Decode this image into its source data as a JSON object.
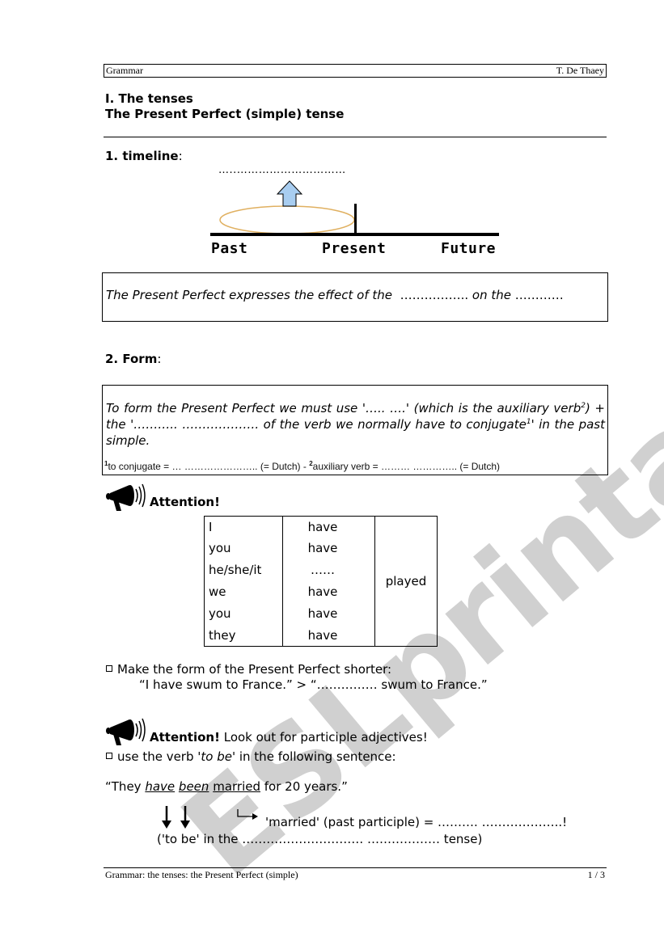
{
  "header": {
    "left": "Grammar",
    "right": "T. De Thaey"
  },
  "titles": {
    "main": "I. The tenses",
    "sub": "The Present Perfect (simple) tense"
  },
  "section1": {
    "heading_num": "1. timeline",
    "heading_colon": ":",
    "timeline": {
      "blank": "…..…………………………",
      "labels": [
        "Past",
        "Present",
        "Future"
      ],
      "colors": {
        "arrow_fill": "#a8cdf0",
        "ellipse_stroke": "#e0b060"
      }
    },
    "box_text": "The Present Perfect expresses the effect of the  …………….. on the ………..",
    "box_parts": {
      "prefix": "The Present Perfect expresses the effect of the",
      "blank1": "……………..",
      "mid": "on the",
      "blank2": "…………"
    }
  },
  "section2": {
    "heading_num": "2. Form",
    "heading_colon": ":",
    "rule": {
      "line1_a": "To form the Present Perfect we must use '….. ….' (which is the auxiliary verb",
      "line1_sup": "2",
      "line1_b": ")",
      "line2_a": "+ the '……….. ………………. of the verb we normally have to conjugate",
      "line2_sup": "1",
      "line2_b": "' in the past simple."
    },
    "footnote": {
      "sup1": "1",
      "part1": "to conjugate = … ………………….. (= Dutch) - ",
      "sup2": "2",
      "part2": "auxiliary verb =  ……… …………..  (= Dutch)"
    }
  },
  "attention1": {
    "label": "Attention!",
    "table": {
      "subjects": [
        "I",
        "you",
        "he/she/it",
        "we",
        "you",
        "they"
      ],
      "auxiliaries": [
        "have",
        "have",
        "……",
        "have",
        "have",
        "have"
      ],
      "participle": "played"
    }
  },
  "shorten": {
    "instruction": "Make the form of the Present Perfect shorter:",
    "example": "“I have swum to France.” > “……………  swum to France.”"
  },
  "attention2": {
    "label": "Attention!",
    "rest": " Look out for participle adjectives!",
    "instruction_a": "use the verb '",
    "instruction_em": "to be",
    "instruction_b": "' in the following sentence:",
    "sentence": {
      "open": "“They ",
      "w1": "have",
      "w2": "been",
      "w3": "married",
      "close": " for 20 years.”"
    },
    "participle_note": "'married' (past participle) = ……….  ………………..!",
    "tense_note": "('to be' in the ………………………… ………………  tense)"
  },
  "footer": {
    "left": "Grammar: the tenses: the Present Perfect (simple)",
    "right": "1 / 3"
  },
  "watermark": "ESLprintables.com"
}
